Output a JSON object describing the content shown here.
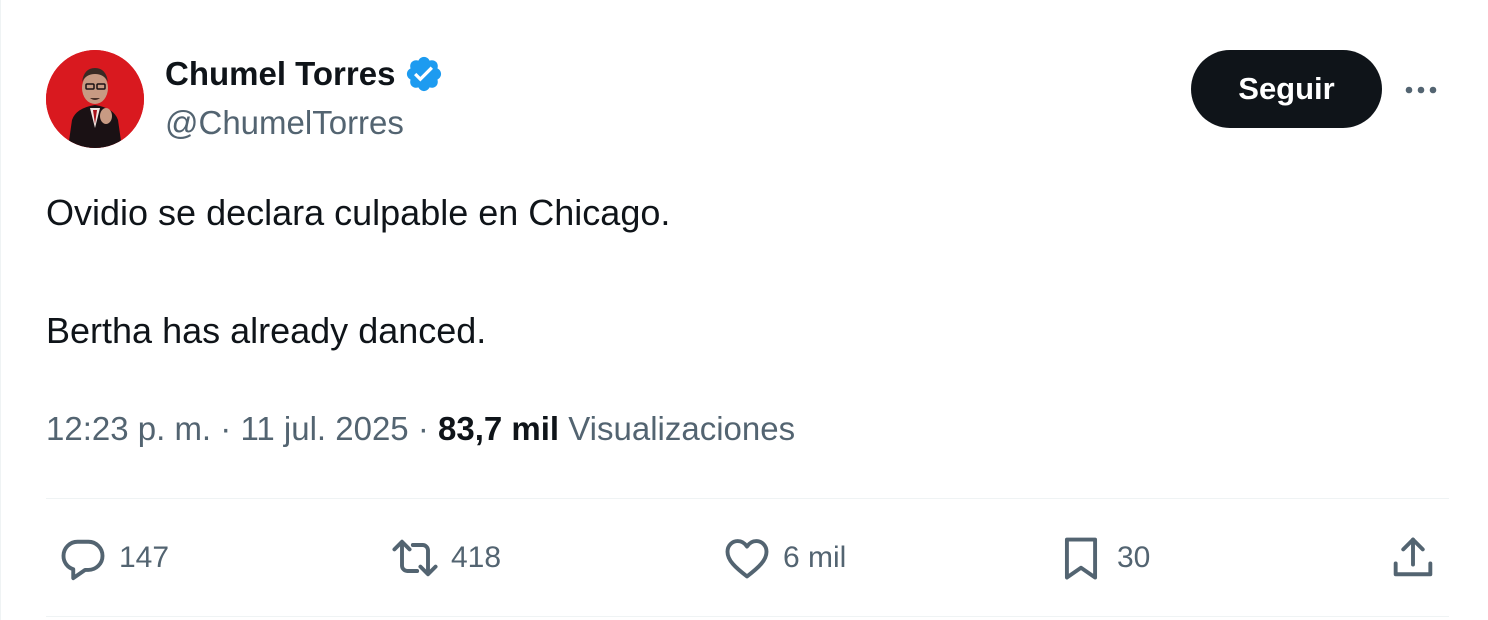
{
  "author": {
    "display_name": "Chumel Torres",
    "handle": "@ChumelTorres",
    "verified_icon": "verified-badge-icon",
    "avatar_color": "#d9191f"
  },
  "header": {
    "follow_label": "Seguir",
    "more_icon": "more-horizontal-icon"
  },
  "tweet": {
    "paragraphs": [
      "Ovidio se declara culpable en Chicago.",
      "Bertha has already danced."
    ]
  },
  "meta": {
    "time": "12:23 p. m.",
    "separator": "·",
    "date": "11 jul. 2025",
    "views_count": "83,7 mil",
    "views_label": "Visualizaciones"
  },
  "actions": {
    "reply": {
      "icon": "reply-icon",
      "count": "147"
    },
    "retweet": {
      "icon": "retweet-icon",
      "count": "418"
    },
    "like": {
      "icon": "heart-icon",
      "count": "6 mil"
    },
    "bookmark": {
      "icon": "bookmark-icon",
      "count": "30"
    },
    "share": {
      "icon": "share-icon"
    }
  },
  "colors": {
    "text_primary": "#0f1419",
    "text_secondary": "#536471",
    "verified_blue": "#1d9bf0",
    "divider": "#eff3f4"
  }
}
